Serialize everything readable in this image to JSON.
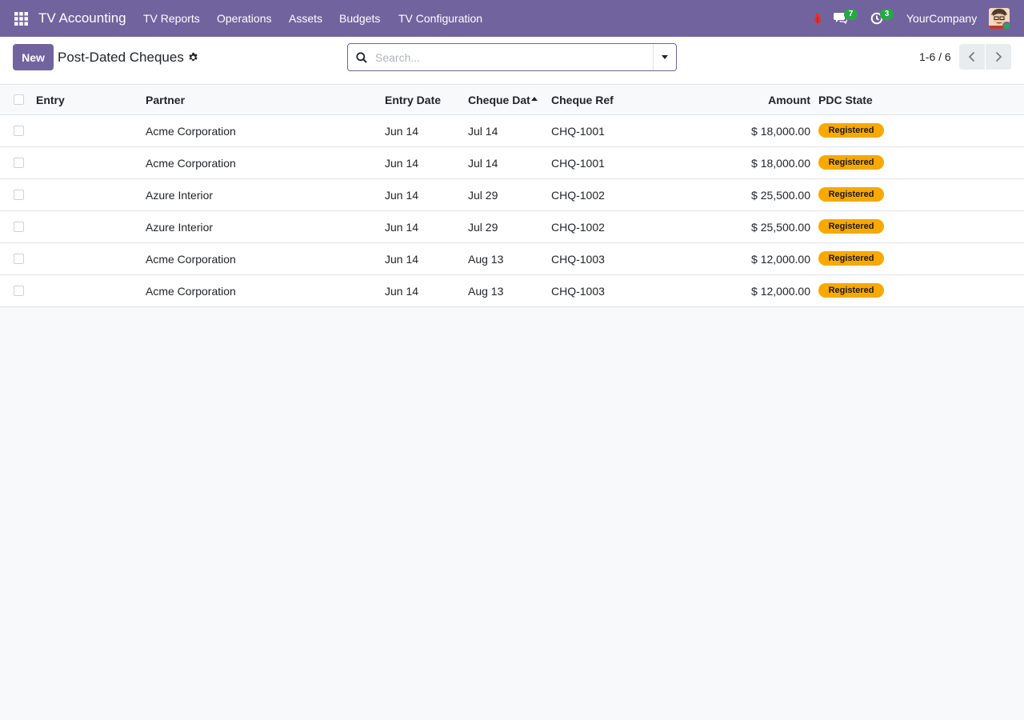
{
  "navbar": {
    "brand": "TV Accounting",
    "menu": [
      "TV Reports",
      "Operations",
      "Assets",
      "Budgets",
      "TV Configuration"
    ],
    "messages_count": "7",
    "activities_count": "3",
    "company": "YourCompany",
    "bg_color": "#71639e"
  },
  "control_panel": {
    "new_label": "New",
    "title": "Post-Dated Cheques",
    "search_placeholder": "Search...",
    "pager_value": "1-6 / 6"
  },
  "table": {
    "columns": [
      "Entry",
      "Partner",
      "Entry Date",
      "Cheque Dat",
      "Cheque Ref",
      "Amount",
      "PDC State"
    ],
    "sorted_column": "Cheque Dat",
    "rows": [
      {
        "entry": "",
        "partner": "Acme Corporation",
        "entry_date": "Jun 14",
        "cheque_date": "Jul 14",
        "cheque_ref": "CHQ-1001",
        "amount": "$ 18,000.00",
        "state": "Registered"
      },
      {
        "entry": "",
        "partner": "Acme Corporation",
        "entry_date": "Jun 14",
        "cheque_date": "Jul 14",
        "cheque_ref": "CHQ-1001",
        "amount": "$ 18,000.00",
        "state": "Registered"
      },
      {
        "entry": "",
        "partner": "Azure Interior",
        "entry_date": "Jun 14",
        "cheque_date": "Jul 29",
        "cheque_ref": "CHQ-1002",
        "amount": "$ 25,500.00",
        "state": "Registered"
      },
      {
        "entry": "",
        "partner": "Azure Interior",
        "entry_date": "Jun 14",
        "cheque_date": "Jul 29",
        "cheque_ref": "CHQ-1002",
        "amount": "$ 25,500.00",
        "state": "Registered"
      },
      {
        "entry": "",
        "partner": "Acme Corporation",
        "entry_date": "Jun 14",
        "cheque_date": "Aug 13",
        "cheque_ref": "CHQ-1003",
        "amount": "$ 12,000.00",
        "state": "Registered"
      },
      {
        "entry": "",
        "partner": "Acme Corporation",
        "entry_date": "Jun 14",
        "cheque_date": "Aug 13",
        "cheque_ref": "CHQ-1003",
        "amount": "$ 12,000.00",
        "state": "Registered"
      }
    ],
    "state_color": "#f8a800"
  }
}
